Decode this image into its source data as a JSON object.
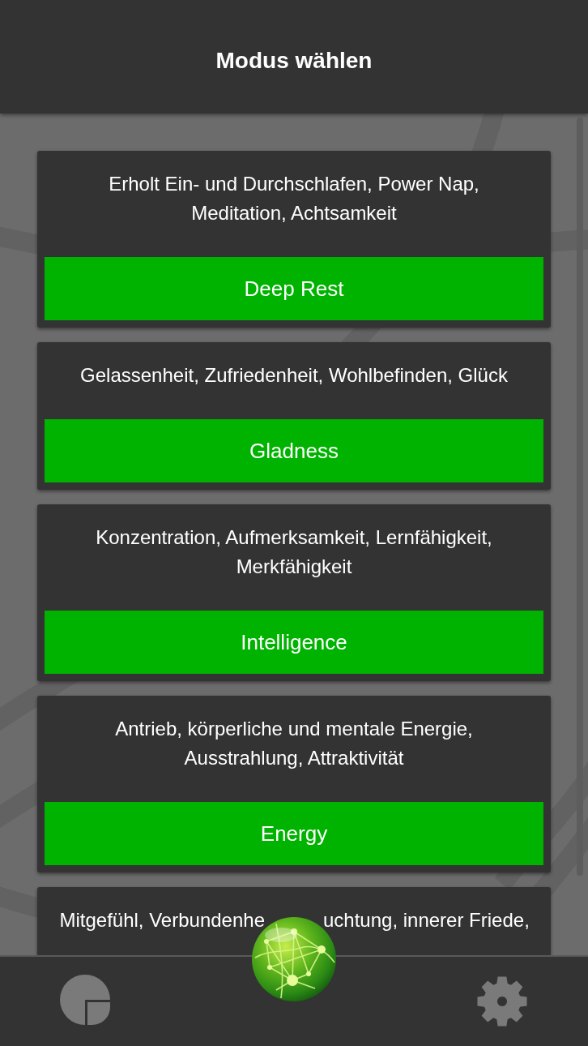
{
  "header": {
    "title": "Modus wählen"
  },
  "modes": [
    {
      "description": "Erholt Ein- und Durchschlafen, Power Nap,\nMeditation, Achtsamkeit",
      "button": "Deep Rest"
    },
    {
      "description": "Gelassenheit, Zufriedenheit, Wohlbefinden, Glück",
      "button": "Gladness"
    },
    {
      "description": "Konzentration, Aufmerksamkeit, Lernfähigkeit,\nMerkfähigkeit",
      "button": "Intelligence"
    },
    {
      "description": "Antrieb, körperliche und mentale Energie,\nAusstrahlung, Attraktivität",
      "button": "Energy"
    },
    {
      "description_fragments": [
        "Mitgefühl, Verbundenhe",
        "uchtung, innerer Friede,"
      ]
    }
  ]
}
